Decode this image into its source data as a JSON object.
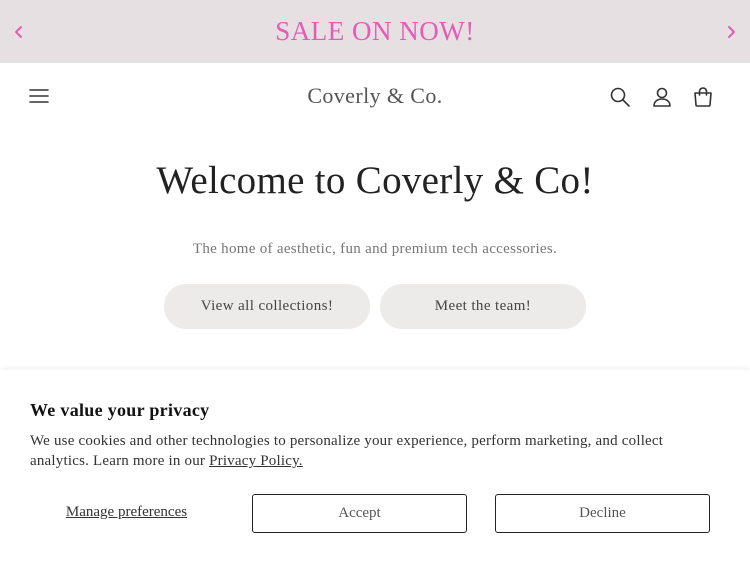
{
  "announcement": {
    "text": "SALE ON NOW!",
    "color": "#e55bb8",
    "background": "#e6e0e2",
    "prev_icon": "chevron-left-icon",
    "next_icon": "chevron-right-icon"
  },
  "header": {
    "logo": "Coverly & Co.",
    "icons": [
      "menu-icon",
      "search-icon",
      "account-icon",
      "cart-icon"
    ]
  },
  "hero": {
    "title": "Welcome to Coverly & Co!",
    "subtitle": "The home of aesthetic, fun and premium tech accessories.",
    "buttons": [
      "View all collections!",
      "Meet the team!"
    ]
  },
  "cookie": {
    "title": "We value your privacy",
    "text": "We use cookies and other technologies to personalize your experience, perform marketing, and collect analytics. Learn more in our ",
    "policy_link": "Privacy Policy.",
    "manage": "Manage preferences",
    "accept": "Accept",
    "decline": "Decline"
  }
}
